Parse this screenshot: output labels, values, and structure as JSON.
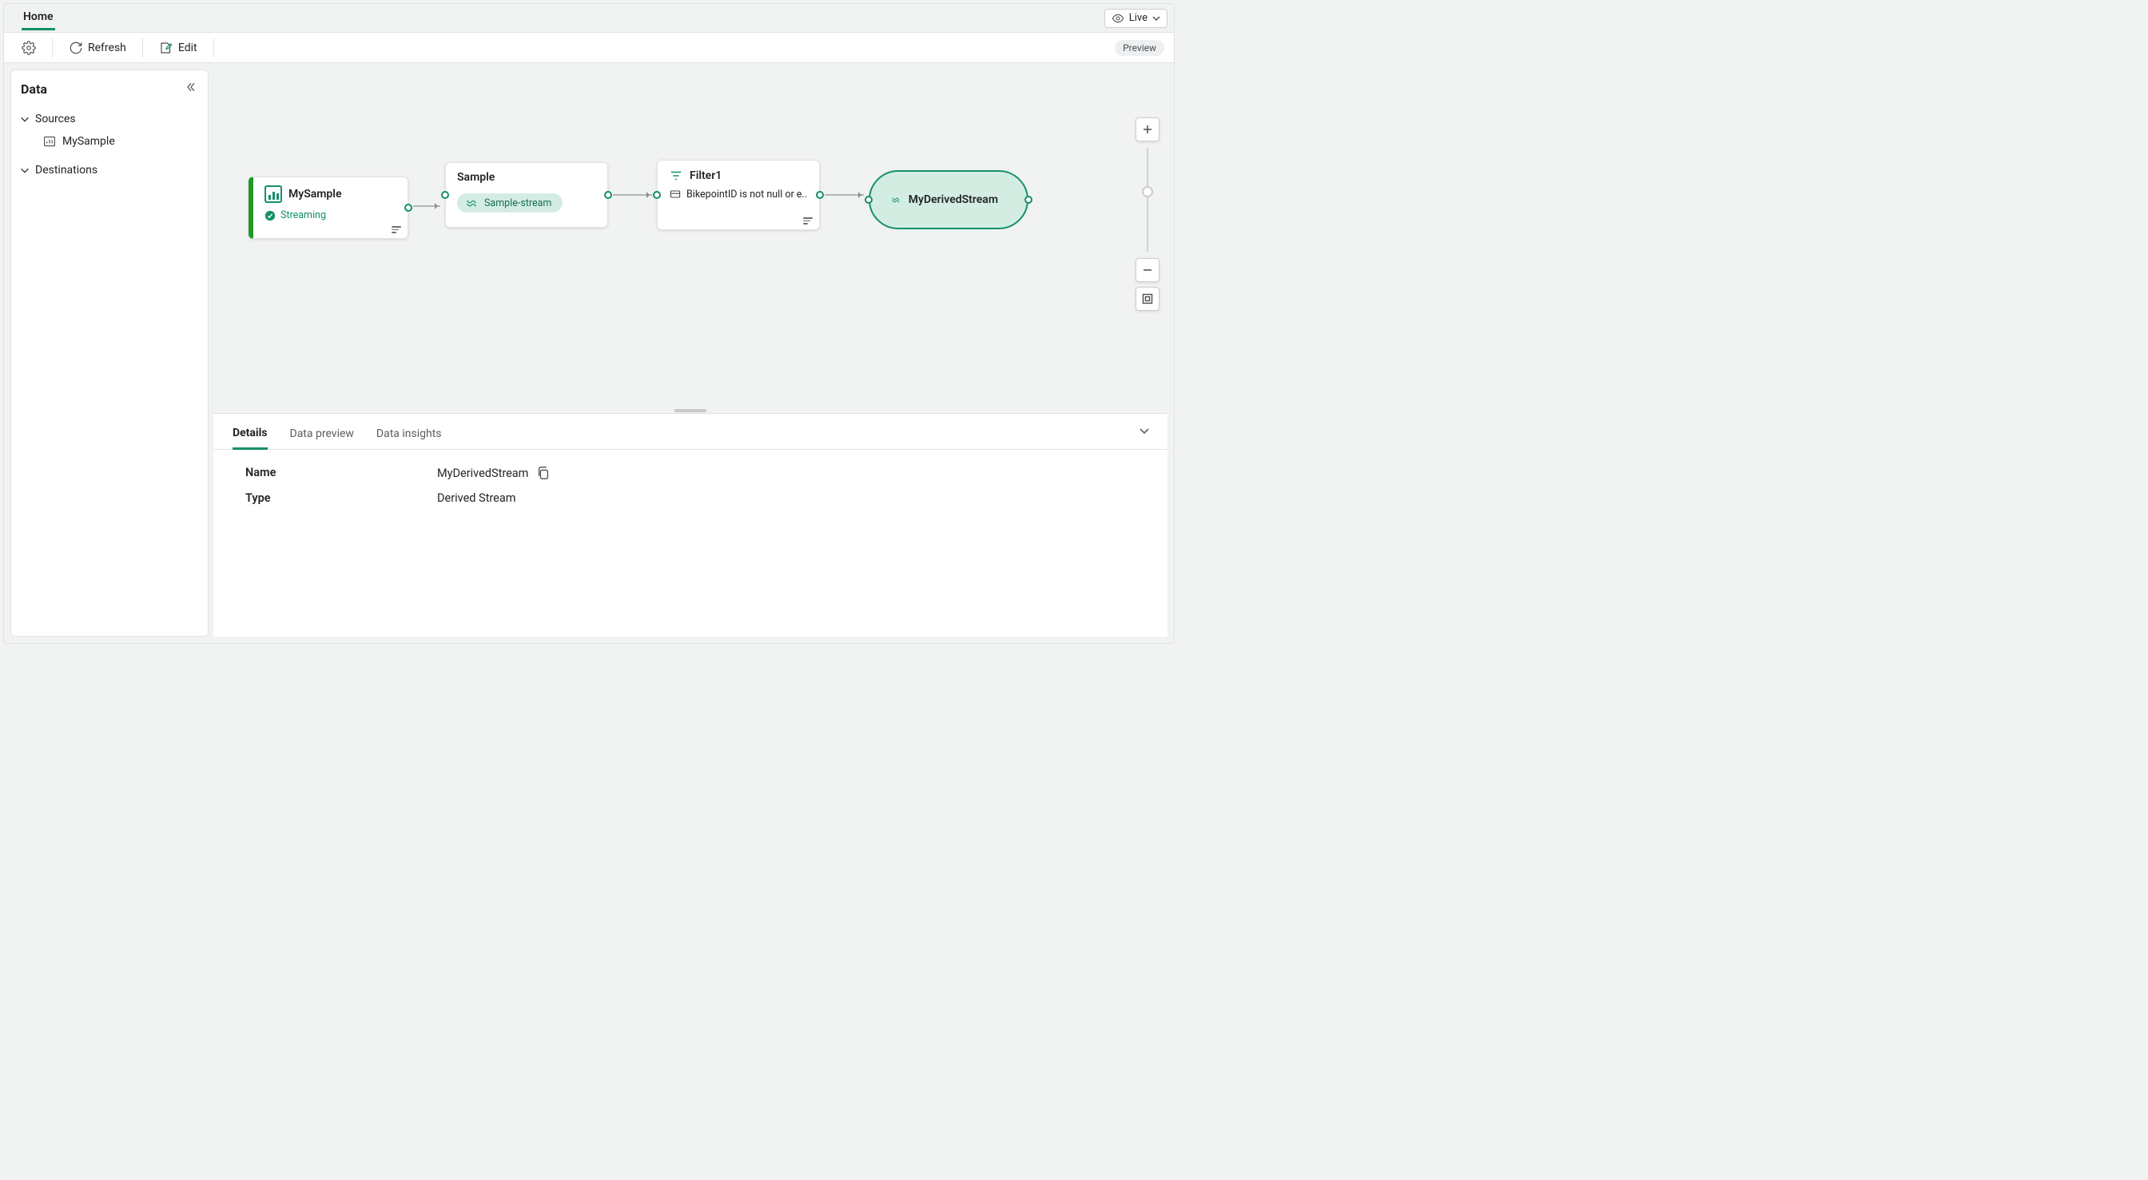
{
  "topbar": {
    "home_tab": "Home",
    "live_label": "Live"
  },
  "toolbar": {
    "refresh_label": "Refresh",
    "edit_label": "Edit",
    "preview_label": "Preview"
  },
  "sidebar": {
    "title": "Data",
    "sources_label": "Sources",
    "destinations_label": "Destinations",
    "source_items": [
      "MySample"
    ]
  },
  "graph": {
    "mysample": {
      "title": "MySample",
      "status": "Streaming"
    },
    "sample": {
      "title": "Sample",
      "pill": "Sample-stream"
    },
    "filter": {
      "title": "Filter1",
      "rule": "BikepointID is not null or e..."
    },
    "derived": {
      "title": "MyDerivedStream"
    }
  },
  "bottom": {
    "tabs": {
      "details": "Details",
      "preview": "Data preview",
      "insights": "Data insights"
    },
    "details": {
      "name_label": "Name",
      "name_value": "MyDerivedStream",
      "type_label": "Type",
      "type_value": "Derived Stream"
    }
  }
}
